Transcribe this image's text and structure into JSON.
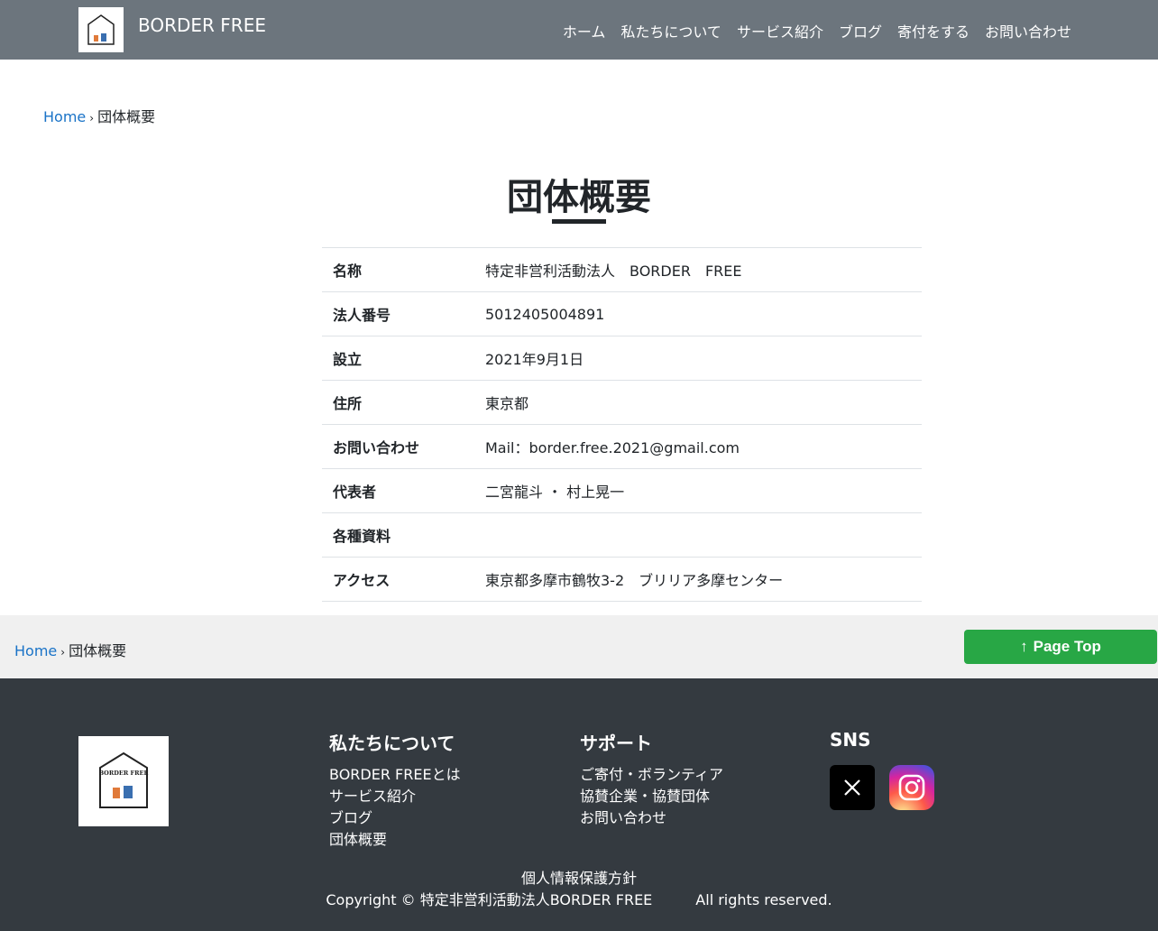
{
  "header": {
    "brand": "BORDER FREE",
    "nav": [
      "ホーム",
      "私たちについて",
      "サービス紹介",
      "ブログ",
      "寄付をする",
      "お問い合わせ"
    ]
  },
  "breadcrumb": {
    "home": "Home",
    "sep": "›",
    "current": "団体概要"
  },
  "page": {
    "title": "団体概要"
  },
  "info_rows": [
    {
      "label": "名称",
      "value": "特定非営利活動法人　BORDER　FREE"
    },
    {
      "label": "法人番号",
      "value": "5012405004891"
    },
    {
      "label": "設立",
      "value": "2021年9月1日"
    },
    {
      "label": "住所",
      "value": "東京都"
    },
    {
      "label": "お問い合わせ",
      "value": "Mail：border.free.2021@gmail.com"
    },
    {
      "label": "代表者",
      "value": "二宮龍斗 ・ 村上晃一"
    },
    {
      "label": "各種資料",
      "value": ""
    },
    {
      "label": "アクセス",
      "value": "東京都多摩市鶴牧3-2　ブリリア多摩センター"
    }
  ],
  "pagetop": {
    "arrow": "↑",
    "label": "Page Top"
  },
  "footer": {
    "about": {
      "heading": "私たちについて",
      "links": [
        "BORDER FREEとは",
        "サービス紹介",
        "ブログ",
        "団体概要"
      ]
    },
    "support": {
      "heading": "サポート",
      "links": [
        "ご寄付・ボランティア",
        "協賛企業・協賛団体",
        "お問い合わせ"
      ]
    },
    "sns": {
      "heading": "SNS",
      "icons": [
        "x-icon",
        "instagram-icon"
      ]
    },
    "privacy": "個人情報保護方針",
    "copyright": "Copyright © 特定非営利活動法人BORDER FREE",
    "rights": "All rights reserved."
  },
  "logo": {
    "text": "BORDER FREE"
  },
  "colors": {
    "header": "#6c757d",
    "footer": "#343a40",
    "pagetop": "#28a745",
    "link": "#1a73c7"
  }
}
